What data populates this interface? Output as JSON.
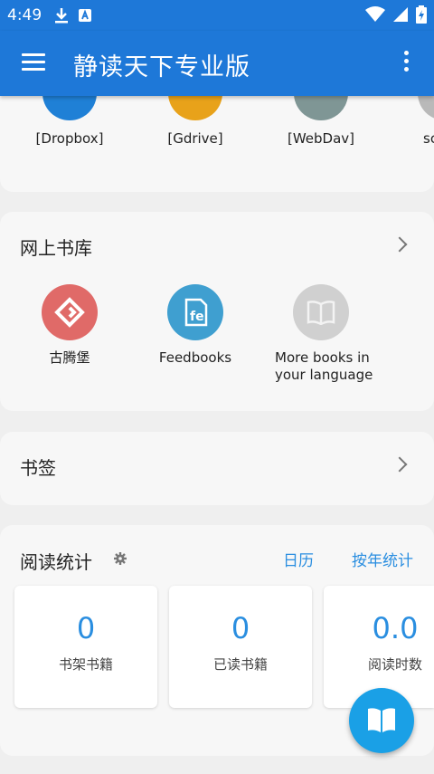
{
  "status_bar": {
    "time": "4:49"
  },
  "app_bar": {
    "title": "静读天下专业版"
  },
  "cloud": {
    "items": [
      {
        "label": "[Dropbox]",
        "color": "#1f80d6"
      },
      {
        "label": "[Gdrive]",
        "color": "#e8a21a"
      },
      {
        "label": "[WebDav]",
        "color": "#7f9695"
      },
      {
        "label": "sc",
        "color": "#b9b9b9"
      }
    ]
  },
  "online_library": {
    "title": "网上书库",
    "items": [
      {
        "label": "古腾堡",
        "color": "#e06a68",
        "icon": "gutenberg-icon"
      },
      {
        "label": "Feedbooks",
        "color": "#3f9fd0",
        "icon": "feedbooks-icon"
      },
      {
        "label": "More books in your language",
        "color": "#d0d0d0",
        "icon": "book-icon"
      }
    ]
  },
  "bookmarks": {
    "title": "书签"
  },
  "stats": {
    "title": "阅读统计",
    "calendar_link": "日历",
    "yearly_link": "按年统计",
    "boxes": [
      {
        "value": "0",
        "label": "书架书籍"
      },
      {
        "value": "0",
        "label": "已读书籍"
      },
      {
        "value": "0.0",
        "label": "阅读时数"
      }
    ]
  },
  "colors": {
    "primary": "#1e78d8",
    "accent": "#2a8ee0",
    "fab": "#1aa0e6"
  }
}
